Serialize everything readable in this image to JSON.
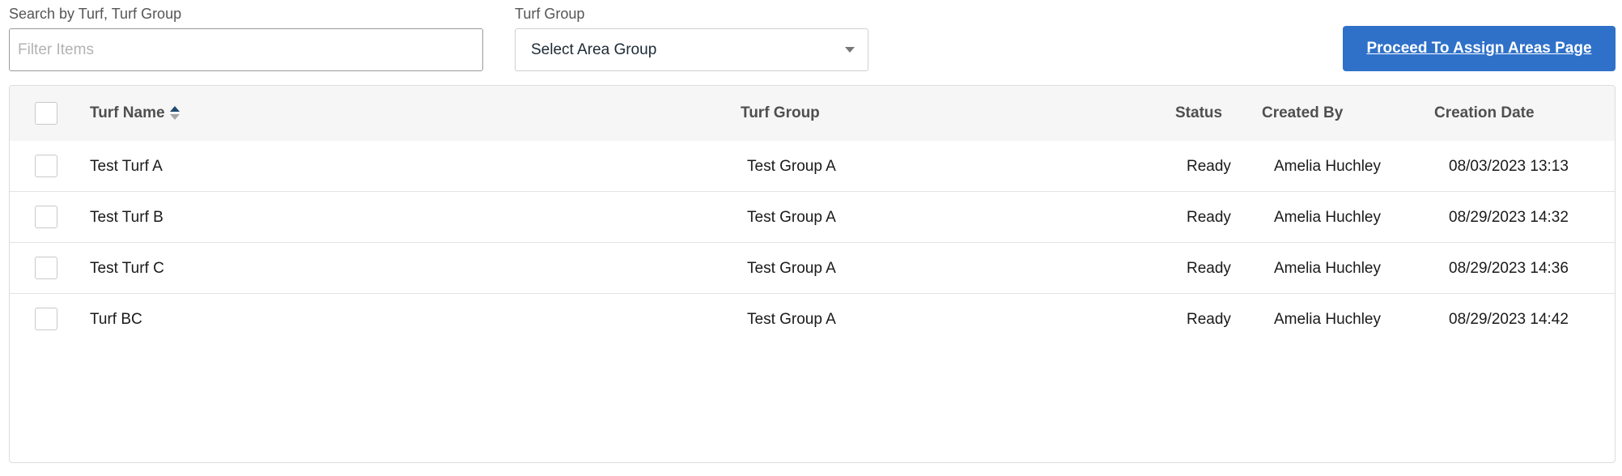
{
  "search": {
    "label": "Search by Turf, Turf Group",
    "placeholder": "Filter Items",
    "value": ""
  },
  "turf_group_filter": {
    "label": "Turf Group",
    "selected": "Select Area Group"
  },
  "proceed_button": {
    "label": "Proceed To Assign Areas Page"
  },
  "table": {
    "columns": {
      "turf_name": "Turf Name",
      "turf_group": "Turf Group",
      "status": "Status",
      "created_by": "Created By",
      "creation_date": "Creation Date"
    },
    "sort": {
      "column": "Turf Name",
      "direction": "ascending"
    },
    "rows": [
      {
        "turf_name": "Test Turf A",
        "turf_group": "Test Group A",
        "status": "Ready",
        "created_by": "Amelia Huchley",
        "creation_date": "08/03/2023 13:13",
        "checked": false
      },
      {
        "turf_name": "Test Turf B",
        "turf_group": "Test Group A",
        "status": "Ready",
        "created_by": "Amelia Huchley",
        "creation_date": "08/29/2023 14:32",
        "checked": false
      },
      {
        "turf_name": "Test Turf C",
        "turf_group": "Test Group A",
        "status": "Ready",
        "created_by": "Amelia Huchley",
        "creation_date": "08/29/2023 14:36",
        "checked": false
      },
      {
        "turf_name": "Turf BC",
        "turf_group": "Test Group A",
        "status": "Ready",
        "created_by": "Amelia Huchley",
        "creation_date": "08/29/2023 14:42",
        "checked": false
      }
    ]
  },
  "colors": {
    "primary_button": "#2f71c9",
    "header_background": "#f6f6f6",
    "sort_active": "#1e4a6e"
  }
}
